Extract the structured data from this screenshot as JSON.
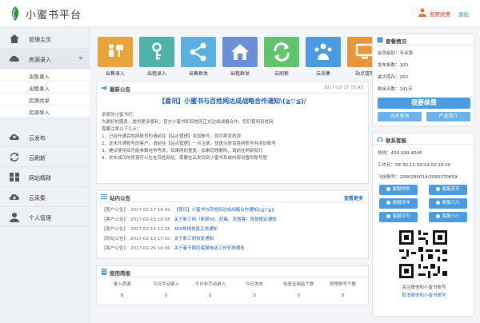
{
  "header": {
    "logo_text": "小蜜书平台",
    "renew_label": "我要续费",
    "logout_label": "退出",
    "colors": {
      "accent": "#2a7fd4",
      "renew": "#d9342b"
    }
  },
  "sidebar": {
    "items": [
      {
        "label": "管理主页",
        "icon": "home-icon"
      },
      {
        "label": "房源录入",
        "icon": "cloud-icon"
      },
      {
        "label": "云发布",
        "icon": "cloud-upload-icon"
      },
      {
        "label": "云刷新",
        "icon": "refresh-icon"
      },
      {
        "label": "网站精耕",
        "icon": "grid-icon"
      },
      {
        "label": "云采集",
        "icon": "cloud-download-icon"
      },
      {
        "label": "个人管理",
        "icon": "user-icon"
      }
    ],
    "sub_items": [
      "出售录入",
      "出租录入",
      "房源共享",
      "房源导入"
    ]
  },
  "tiles": [
    {
      "label": "出售录入",
      "icon": "sale-icon",
      "color": "#e9a33b"
    },
    {
      "label": "出租录入",
      "icon": "key-icon",
      "color": "#4fb3a8"
    },
    {
      "label": "出售群发",
      "icon": "share-icon",
      "color": "#5bb0df"
    },
    {
      "label": "出租群发",
      "icon": "house-icon",
      "color": "#6a8fd6"
    },
    {
      "label": "云刷新",
      "icon": "refresh-icon",
      "color": "#62c36e"
    },
    {
      "label": "云采集",
      "icon": "people-icon",
      "color": "#4a9be0"
    },
    {
      "label": "站点管理",
      "icon": "monitor-icon",
      "color": "#e8963b"
    }
  ],
  "announcement": {
    "title": "最新公告",
    "date": "2017-02-17 15:42",
    "headline": "【喜讯】小蜜书与百姓网达成战略合作通知\\(≧▽≦)/",
    "lines": [
      "亲爱的小蜜书们：",
      "为更好的服务，提供更多便利，官方小蜜书和百姓网正式达成战略合作，您们使用百姓网",
      "需要注意以下几点：",
      "1、已经开通百姓网账号的请前往【站点管理】添加账号，就可群发房源",
      "2、还未开通账号的客户，请前往【站点管理】一点注册，快速注册百姓网账号并添加账号",
      "3、建议使用如可能参数经常考虑，如果网的重复，如果您想删除，请前往刷新就行",
      "4、发布成功的房源可以在在百姓网站，需要在云发到到小蜜书系统内部设置的账号管"
    ]
  },
  "news": {
    "title": "站内公告",
    "more_label": "查看更多",
    "items": [
      {
        "tag": "【客户公告】",
        "time": "2017-02-17 15:42",
        "text": "【喜讯】小蜜书与百姓网达成战略合作通知\\(≧▽≦)/"
      },
      {
        "tag": "【客户公告】",
        "time": "2017-02-15 10:58",
        "text": "关于新三网（新版58、赶集、安居客）恢复稳定通知"
      },
      {
        "tag": "【客户公告】",
        "time": "2017-02-14 11:28",
        "text": "400热线恢复正常通知"
      },
      {
        "tag": "【网站公告】",
        "time": "2017-02-13 17:10",
        "text": "关于新三网恢复通知"
      },
      {
        "tag": "【客户公告】",
        "time": "2017-01-25 10:06",
        "text": "关于春节期间客服电话工作安排通告"
      }
    ]
  },
  "stats": {
    "title": "使用简报",
    "headers": [
      "录入房源",
      "今日手动录入",
      "今日非手动录入",
      "今日发布",
      "待验证网站个数",
      "异常账号个数"
    ],
    "values": [
      "6",
      "0",
      "0",
      "0",
      "0",
      "0"
    ]
  },
  "account": {
    "title": "套餐情况",
    "rows": [
      {
        "label": "会员级别：",
        "value": "专业版"
      },
      {
        "label": "发布条数：",
        "value": "100"
      },
      {
        "label": "最大库存：",
        "value": "200"
      },
      {
        "label": "剩余天数：",
        "value": "141天"
      }
    ],
    "renew_button": "我要续费",
    "recharge_button": "流水查询",
    "product_button": "产品简介"
  },
  "support": {
    "title": "联系客服",
    "phone_label": "热线：",
    "phone": "400-999-4046",
    "hours_label": "工作日：",
    "hours": "08:30-12:00/14:00-18:00",
    "fax_label": "飞信账号：",
    "fax": "2066286014/2066370859",
    "buttons": [
      "客服悦悦",
      "客服芳芳",
      "客服洋洋",
      "客服六六",
      "客服可可",
      "客服小小"
    ],
    "qr_caption_1": "关注微信和小蜜书账号",
    "qr_caption_2": "取消微信和小蜜书账号"
  }
}
